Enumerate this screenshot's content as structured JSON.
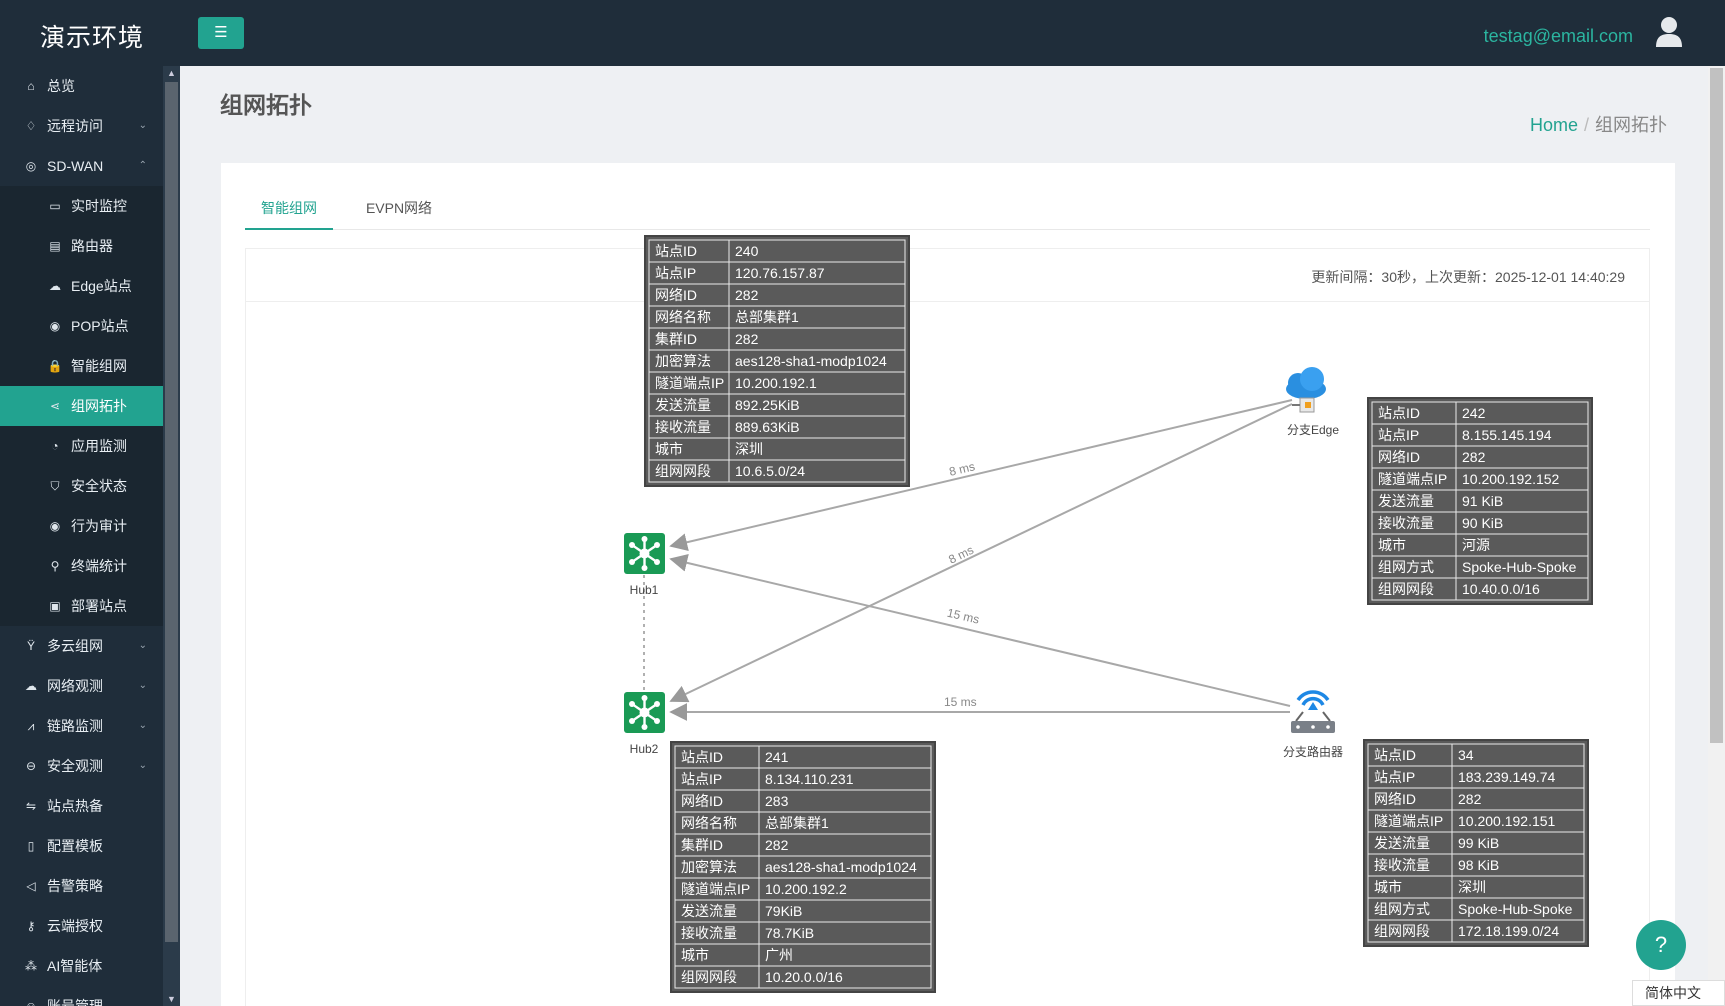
{
  "app": {
    "brand": "演示环境",
    "user_email": "testag@email.com"
  },
  "sidebar": {
    "items": [
      {
        "label": "总览",
        "icon": "home-icon",
        "glyph": "⌂"
      },
      {
        "label": "远程访问",
        "icon": "rocket-icon",
        "glyph": "♢",
        "chevron": "⌄"
      },
      {
        "label": "SD-WAN",
        "icon": "globe-icon",
        "glyph": "◎",
        "chevron": "⌃"
      },
      {
        "label": "实时监控",
        "icon": "monitor-icon",
        "glyph": "▭",
        "sub": true
      },
      {
        "label": "路由器",
        "icon": "router-icon",
        "glyph": "▤",
        "sub": true
      },
      {
        "label": "Edge站点",
        "icon": "cloud-icon",
        "glyph": "☁",
        "sub": true
      },
      {
        "label": "POP站点",
        "icon": "location-icon",
        "glyph": "◉",
        "sub": true
      },
      {
        "label": "智能组网",
        "icon": "lock-icon",
        "glyph": "🔒",
        "sub": true
      },
      {
        "label": "组网拓扑",
        "icon": "share-icon",
        "glyph": "⋖",
        "sub": true,
        "active": true
      },
      {
        "label": "应用监测",
        "icon": "pie-chart-icon",
        "glyph": "◔",
        "sub": true
      },
      {
        "label": "安全状态",
        "icon": "shield-icon",
        "glyph": "⛉",
        "sub": true
      },
      {
        "label": "行为审计",
        "icon": "eye-icon",
        "glyph": "◉",
        "sub": true
      },
      {
        "label": "终端统计",
        "icon": "search-icon",
        "glyph": "⚲",
        "sub": true
      },
      {
        "label": "部署站点",
        "icon": "box-icon",
        "glyph": "▣",
        "sub": true
      },
      {
        "label": "多云组网",
        "icon": "fork-icon",
        "glyph": "Ÿ",
        "chevron": "⌄"
      },
      {
        "label": "网络观测",
        "icon": "cloud-outline-icon",
        "glyph": "☁",
        "chevron": "⌄"
      },
      {
        "label": "链路监测",
        "icon": "line-chart-icon",
        "glyph": "⩘",
        "chevron": "⌄"
      },
      {
        "label": "安全观测",
        "icon": "minus-circle-icon",
        "glyph": "⊖",
        "chevron": "⌄"
      },
      {
        "label": "站点热备",
        "icon": "swap-icon",
        "glyph": "⇋"
      },
      {
        "label": "配置模板",
        "icon": "file-icon",
        "glyph": "▯"
      },
      {
        "label": "告警策略",
        "icon": "megaphone-icon",
        "glyph": "◁"
      },
      {
        "label": "云端授权",
        "icon": "key-icon",
        "glyph": "⚷"
      },
      {
        "label": "AI智能体",
        "icon": "cluster-icon",
        "glyph": "⁂"
      },
      {
        "label": "账号管理",
        "icon": "user-icon",
        "glyph": "☺"
      }
    ]
  },
  "page": {
    "title": "组网拓扑"
  },
  "breadcrumb": {
    "home": "Home",
    "sep": "/",
    "current": "组网拓扑"
  },
  "tabs": [
    {
      "label": "智能组网",
      "active": true
    },
    {
      "label": "EVPN网络",
      "active": false
    }
  ],
  "update_info": "更新间隔：30秒，上次更新：2025-12-01 14:40:29",
  "topology": {
    "nodes": {
      "hub1": {
        "label": "Hub1"
      },
      "hub2": {
        "label": "Hub2"
      },
      "edge": {
        "label": "分支Edge"
      },
      "router": {
        "label": "分支路由器"
      }
    },
    "links": [
      {
        "from": "edge",
        "to": "hub1",
        "latency": "8 ms"
      },
      {
        "from": "edge",
        "to": "hub2",
        "latency": "8 ms"
      },
      {
        "from": "router",
        "to": "hub1",
        "latency": "15 ms"
      },
      {
        "from": "router",
        "to": "hub2",
        "latency": "15 ms"
      }
    ],
    "info_tables": {
      "hub1": [
        [
          "站点ID",
          "240"
        ],
        [
          "站点IP",
          "120.76.157.87"
        ],
        [
          "网络ID",
          "282"
        ],
        [
          "网络名称",
          "总部集群1"
        ],
        [
          "集群ID",
          "282"
        ],
        [
          "加密算法",
          "aes128-sha1-modp1024"
        ],
        [
          "隧道端点IP",
          "10.200.192.1"
        ],
        [
          "发送流量",
          "892.25KiB"
        ],
        [
          "接收流量",
          "889.63KiB"
        ],
        [
          "城市",
          "深圳"
        ],
        [
          "组网网段",
          "10.6.5.0/24"
        ]
      ],
      "edge": [
        [
          "站点ID",
          "242"
        ],
        [
          "站点IP",
          "8.155.145.194"
        ],
        [
          "网络ID",
          "282"
        ],
        [
          "隧道端点IP",
          "10.200.192.152"
        ],
        [
          "发送流量",
          "91 KiB"
        ],
        [
          "接收流量",
          "90 KiB"
        ],
        [
          "城市",
          "河源"
        ],
        [
          "组网方式",
          "Spoke-Hub-Spoke"
        ],
        [
          "组网网段",
          "10.40.0.0/16"
        ]
      ],
      "hub2": [
        [
          "站点ID",
          "241"
        ],
        [
          "站点IP",
          "8.134.110.231"
        ],
        [
          "网络ID",
          "283"
        ],
        [
          "网络名称",
          "总部集群1"
        ],
        [
          "集群ID",
          "282"
        ],
        [
          "加密算法",
          "aes128-sha1-modp1024"
        ],
        [
          "隧道端点IP",
          "10.200.192.2"
        ],
        [
          "发送流量",
          "79KiB"
        ],
        [
          "接收流量",
          "78.7KiB"
        ],
        [
          "城市",
          "广州"
        ],
        [
          "组网网段",
          "10.20.0.0/16"
        ]
      ],
      "router": [
        [
          "站点ID",
          "34"
        ],
        [
          "站点IP",
          "183.239.149.74"
        ],
        [
          "网络ID",
          "282"
        ],
        [
          "隧道端点IP",
          "10.200.192.151"
        ],
        [
          "发送流量",
          "99 KiB"
        ],
        [
          "接收流量",
          "98 KiB"
        ],
        [
          "城市",
          "深圳"
        ],
        [
          "组网方式",
          "Spoke-Hub-Spoke"
        ],
        [
          "组网网段",
          "172.18.199.0/24"
        ]
      ]
    }
  },
  "footer": {
    "help_glyph": "?",
    "language": "简体中文"
  },
  "colors": {
    "accent": "#22a390",
    "topbar": "#1f2d3a",
    "hub": "#1a9a55",
    "edge_cloud": "#2a8fe0",
    "router": "#1e88e5"
  }
}
